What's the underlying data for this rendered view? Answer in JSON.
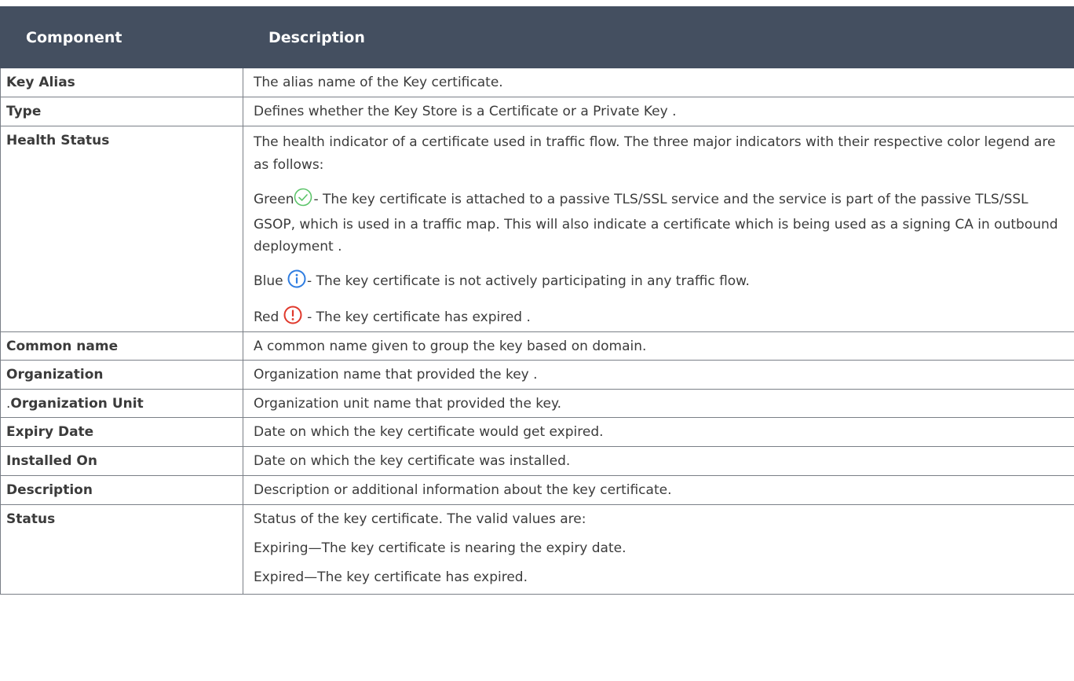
{
  "table": {
    "headers": {
      "component": "Component",
      "description": "Description"
    },
    "rows": [
      {
        "name": "Key Alias",
        "desc": "The alias name of the Key certificate."
      },
      {
        "name": "Type",
        "desc": "Defines whether the Key Store is a Certificate or a Private Key ."
      },
      {
        "name": "Health Status",
        "desc_intro": "The health indicator of a certificate used in traffic flow. The three major indicators with their respective color legend are as follows:",
        "green_label": "Green",
        "green_text": "- The key certificate is attached to a passive TLS/SSL service and the service is part of the passive TLS/SSL GSOP, which is used in a traffic map. This will also indicate a certificate which is being used as a signing CA in outbound deployment .",
        "blue_label": "Blue",
        "blue_text": "- The key certificate is not actively participating in any traffic flow.",
        "red_label": "Red",
        "red_text": " - The key certificate has expired ."
      },
      {
        "name": "Common name",
        "desc": "A common name given to group the key based on domain."
      },
      {
        "name": "Organization",
        "desc": "Organization name that provided the key ."
      },
      {
        "name_prefix": ".",
        "name": "Organization Unit",
        "desc": "Organization unit name that provided the key."
      },
      {
        "name": "Expiry Date",
        "desc": "Date on which the key certificate would get expired."
      },
      {
        "name": "Installed On",
        "desc": "Date on which the key certificate was installed."
      },
      {
        "name": "Description",
        "desc": "Description or additional information about the key certificate."
      },
      {
        "name": "Status",
        "lines": [
          "Status of the key certificate. The valid values are:",
          "Expiring—The key certificate is nearing the expiry date.",
          "Expired—The key certificate has expired."
        ]
      }
    ]
  },
  "icons": {
    "green": {
      "name": "check-circle-icon",
      "color": "#5cc46a"
    },
    "blue": {
      "name": "info-circle-icon",
      "color": "#2f7de1"
    },
    "red": {
      "name": "alert-circle-icon",
      "color": "#e0382b"
    }
  },
  "colors": {
    "header_bg": "#444f60",
    "header_text": "#ffffff",
    "border": "#7a7f87",
    "text": "#3b3b3b"
  }
}
